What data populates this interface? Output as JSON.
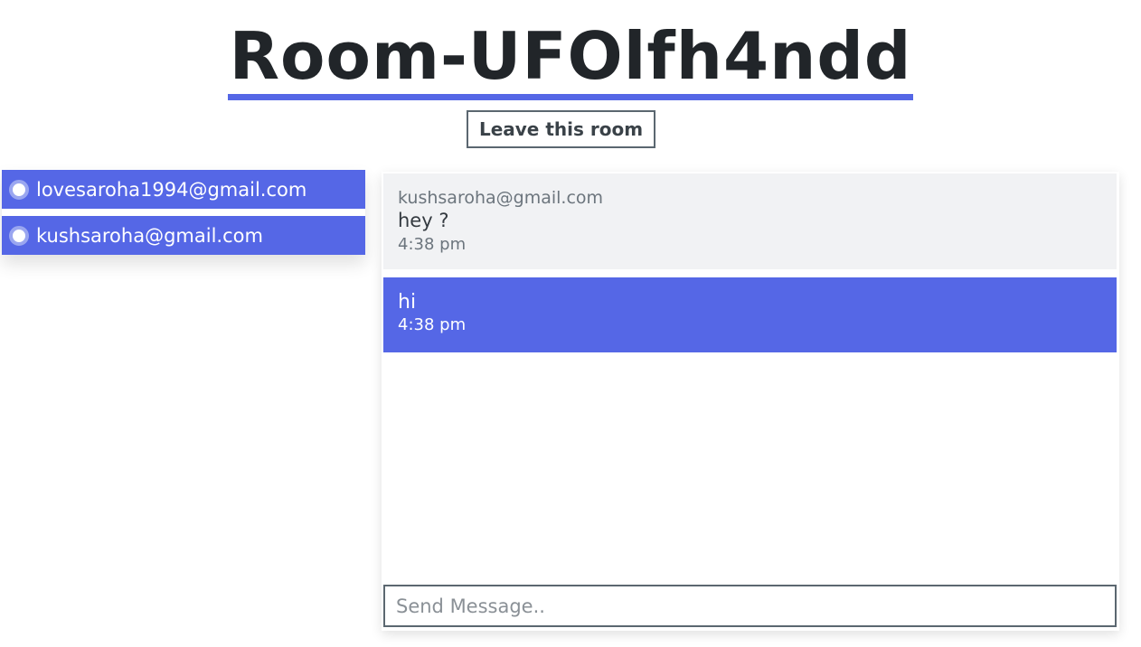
{
  "room": {
    "title": "Room-UFOlfh4ndd",
    "leave_label": "Leave this room"
  },
  "users": [
    {
      "email": "lovesaroha1994@gmail.com"
    },
    {
      "email": "kushsaroha@gmail.com"
    }
  ],
  "messages": [
    {
      "sender": "kushsaroha@gmail.com",
      "text": "hey ?",
      "time": "4:38 pm"
    },
    {
      "text": "hi",
      "time": "4:38 pm"
    }
  ],
  "composer": {
    "value": "",
    "placeholder": "Send Message.."
  },
  "colors": {
    "accent": "#5567e6",
    "received_bg": "#f1f2f4",
    "text_dark": "#212529"
  }
}
